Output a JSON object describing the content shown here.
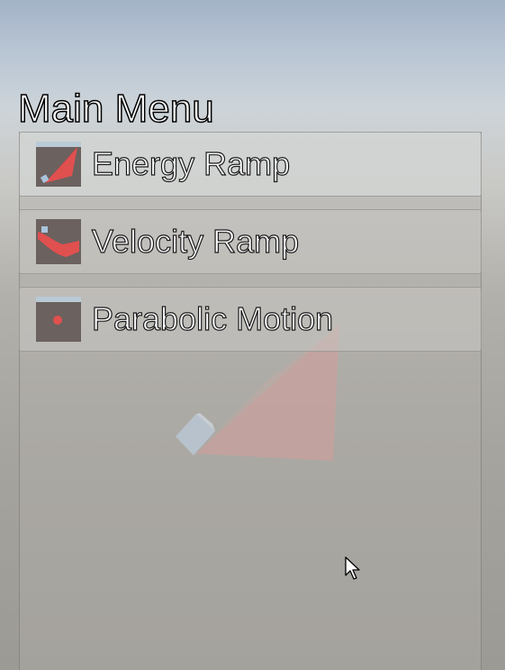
{
  "menu": {
    "title": "Main Menu",
    "items": [
      {
        "label": "Energy Ramp",
        "icon": "energy-ramp-thumbnail"
      },
      {
        "label": "Velocity Ramp",
        "icon": "velocity-ramp-thumbnail"
      },
      {
        "label": "Parabolic Motion",
        "icon": "parabolic-motion-thumbnail"
      }
    ]
  },
  "colors": {
    "sky_top": "#a3b3c7",
    "ground": "#a6a49f",
    "ramp_red": "#e98f8f",
    "cube_blue": "#b9d1e8",
    "thumb_bg": "#6b615e",
    "title_text": "#ffffff",
    "title_outline": "#000000"
  },
  "cursor": {
    "icon": "arrow-cursor-icon"
  }
}
